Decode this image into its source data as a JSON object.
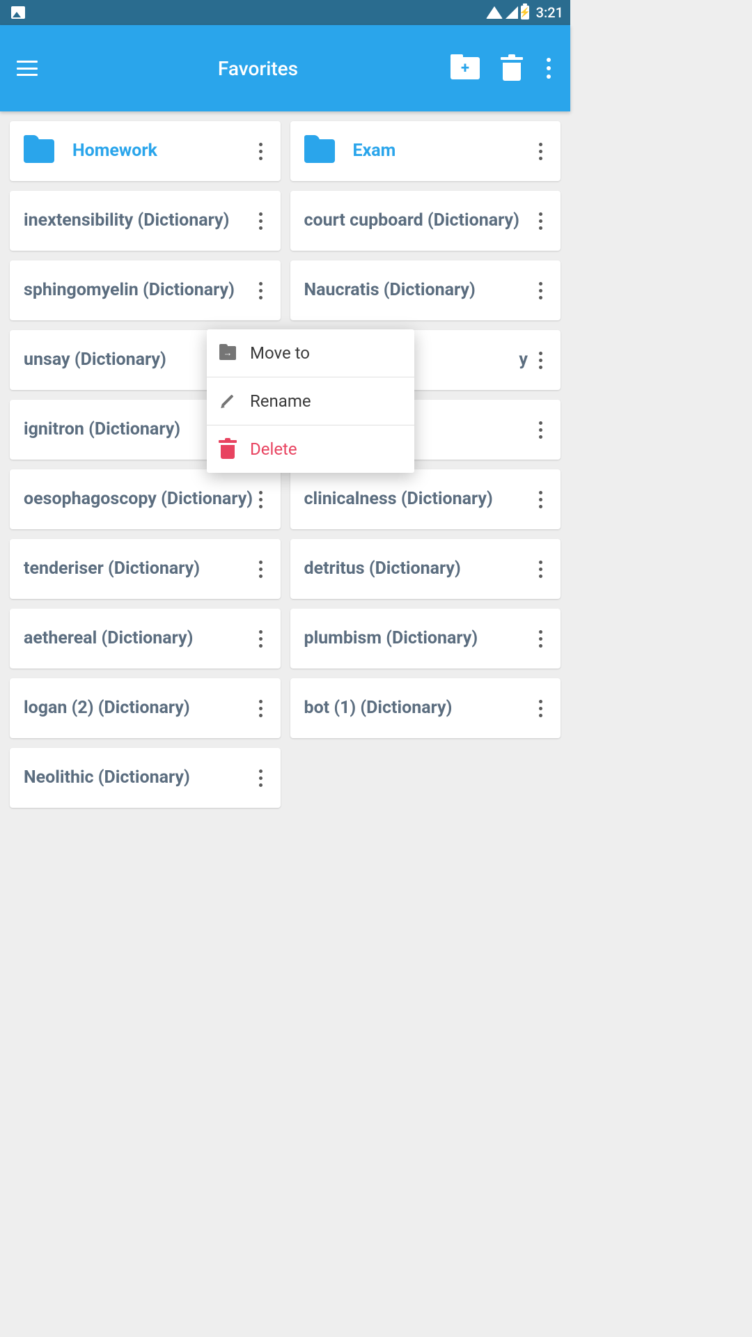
{
  "status_bar": {
    "time": "3:21"
  },
  "app_bar": {
    "title": "Favorites"
  },
  "folders": [
    {
      "name": "Homework"
    },
    {
      "name": "Exam"
    }
  ],
  "left_items": [
    {
      "title": "inextensibility (Dictionary)"
    },
    {
      "title": "sphingomyelin (Dictionary)"
    },
    {
      "title": "unsay (Dictionary)"
    },
    {
      "title": "ignitron (Dictionary)"
    },
    {
      "title": "oesophagoscopy (Dictionary)"
    },
    {
      "title": "tenderiser (Dictionary)"
    },
    {
      "title": "aethereal (Dictionary)"
    },
    {
      "title": "logan (2) (Dictionary)"
    },
    {
      "title": "Neolithic (Dictionary)"
    }
  ],
  "right_items": [
    {
      "title": "court cupboard (Dictionary)"
    },
    {
      "title": "Naucratis (Dictionary)"
    },
    {
      "title": "y"
    },
    {
      "title": ""
    },
    {
      "title": "clinicalness (Dictionary)"
    },
    {
      "title": "detritus (Dictionary)"
    },
    {
      "title": "plumbism (Dictionary)"
    },
    {
      "title": "bot (1) (Dictionary)"
    }
  ],
  "popup": {
    "move": "Move to",
    "rename": "Rename",
    "delete": "Delete"
  }
}
